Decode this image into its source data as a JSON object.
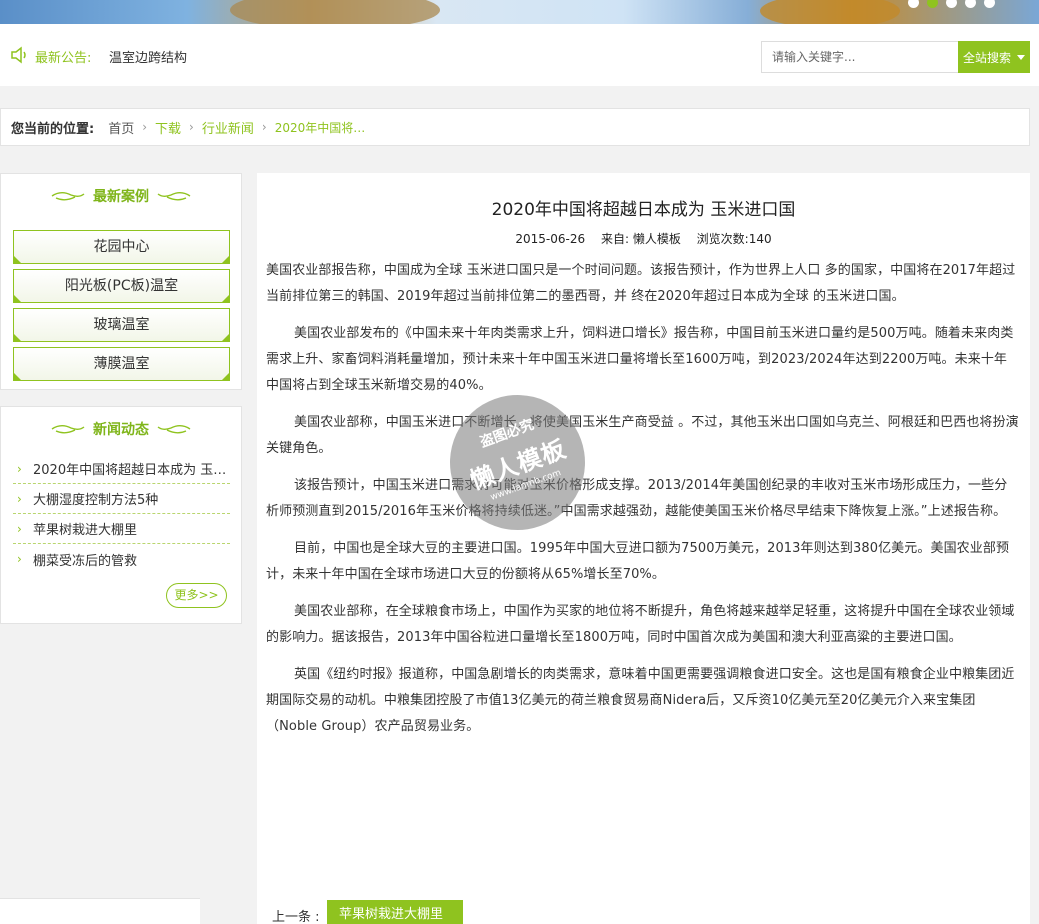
{
  "banner": {
    "slides": 5,
    "active_slide": 2
  },
  "notice": {
    "label": "最新公告:",
    "text": "温室边跨结构"
  },
  "search": {
    "placeholder": "请输入关键字...",
    "button_label": "全站搜索"
  },
  "breadcrumb": {
    "lead": "您当前的位置:",
    "home": "首页",
    "items": [
      "下载",
      "行业新闻",
      "2020年中国将…"
    ]
  },
  "sidebar": {
    "cases": {
      "title": "最新案例",
      "items": [
        "花园中心",
        "阳光板(PC板)温室",
        "玻璃温室",
        "薄膜温室"
      ]
    },
    "news": {
      "title": "新闻动态",
      "items": [
        "2020年中国将超越日本成为 玉米进口国",
        "大棚湿度控制方法5种",
        "苹果树栽进大棚里",
        "棚菜受冻后的管救"
      ],
      "more_label": "更多>>"
    }
  },
  "article": {
    "title": "2020年中国将超越日本成为 玉米进口国",
    "date": "2015-06-26",
    "source": "来自: 懒人模板",
    "views": "浏览次数:140",
    "paragraphs": [
      "美国农业部报告称，中国成为全球 玉米进口国只是一个时间问题。该报告预计，作为世界上人口 多的国家，中国将在2017年超过当前排位第三的韩国、2019年超过当前排位第二的墨西哥，并 终在2020年超过日本成为全球 的玉米进口国。",
      "美国农业部发布的《中国未来十年肉类需求上升，饲料进口增长》报告称，中国目前玉米进口量约是500万吨。随着未来肉类需求上升、家畜饲料消耗量增加，预计未来十年中国玉米进口量将增长至1600万吨，到2023/2024年达到2200万吨。未来十年中国将占到全球玉米新增交易的40%。",
      "美国农业部称，中国玉米进口不断增长，将使美国玉米生产商受益 。不过，其他玉米出口国如乌克兰、阿根廷和巴西也将扮演关键角色。",
      "该报告预计，中国玉米进口需求有可能对玉米价格形成支撑。2013/2014年美国创纪录的丰收对玉米市场形成压力，一些分析师预测直到2015/2016年玉米价格将持续低迷。”中国需求越强劲，越能使美国玉米价格尽早结束下降恢复上涨。”上述报告称。",
      "目前，中国也是全球大豆的主要进口国。1995年中国大豆进口额为7500万美元，2013年则达到380亿美元。美国农业部预计，未来十年中国在全球市场进口大豆的份额将从65%增长至70%。",
      "美国农业部称，在全球粮食市场上，中国作为买家的地位将不断提升，角色将越来越举足轻重，这将提升中国在全球农业领域的影响力。据该报告，2013年中国谷粒进口量增长至1800万吨，同时中国首次成为美国和澳大利亚高粱的主要进口国。",
      "英国《纽约时报》报道称，中国急剧增长的肉类需求，意味着中国更需要强调粮食进口安全。这也是国有粮食企业中粮集团近期国际交易的动机。中粮集团控股了市值13亿美元的荷兰粮食贸易商Nidera后，又斥资10亿美元至20亿美元介入来宝集团（Noble Group）农产品贸易业务。"
    ],
    "prev_label": "上一条 :",
    "prev_link": "苹果树栽进大棚里"
  },
  "watermark": {
    "line1": "盗图必究",
    "line2": "懒人模板",
    "line3": "www.lanmb.com"
  },
  "colors": {
    "accent": "#8fc31f",
    "background": "#f2f2f2"
  }
}
